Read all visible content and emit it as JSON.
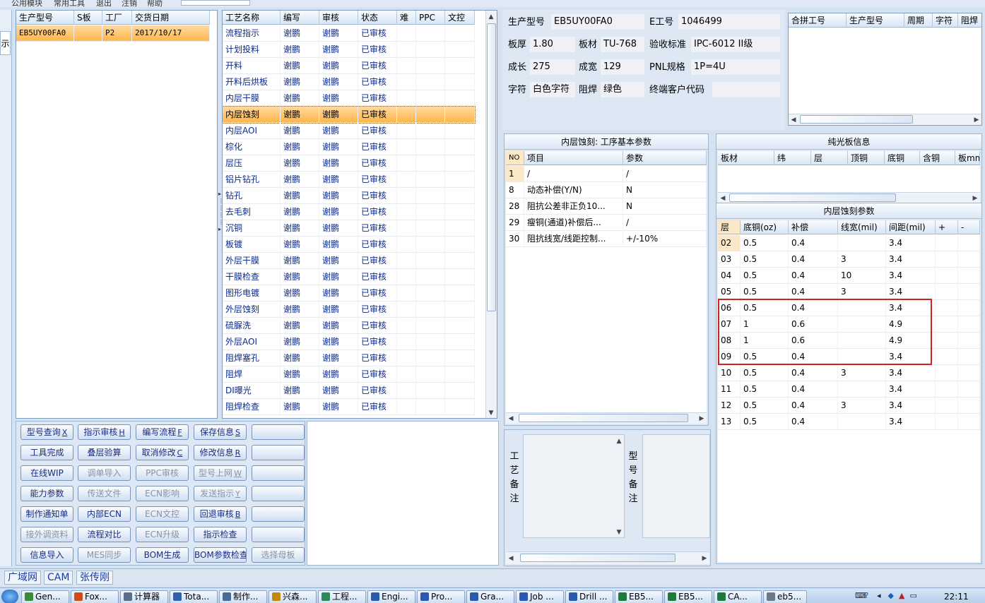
{
  "menu": [
    "公用模块",
    "常用工具",
    "退出",
    "注销",
    "帮助"
  ],
  "left_sidebar_label": "示",
  "order_table": {
    "headers": [
      "生产型号",
      "S板",
      "工厂",
      "交货日期"
    ],
    "rows": [
      [
        "EB5UY00FA0",
        "",
        "P2",
        "2017/10/17"
      ]
    ]
  },
  "process_table": {
    "headers": [
      "工艺名称",
      "编写",
      "审核",
      "状态",
      "难",
      "PPC",
      "文控"
    ],
    "selected_index": 5,
    "rows": [
      [
        "流程指示",
        "谢鹏",
        "谢鹏",
        "已审核"
      ],
      [
        "计划投料",
        "谢鹏",
        "谢鹏",
        "已审核"
      ],
      [
        "开料",
        "谢鹏",
        "谢鹏",
        "已审核"
      ],
      [
        "开料后烘板",
        "谢鹏",
        "谢鹏",
        "已审核"
      ],
      [
        "内层干膜",
        "谢鹏",
        "谢鹏",
        "已审核"
      ],
      [
        "内层蚀刻",
        "谢鹏",
        "谢鹏",
        "已审核"
      ],
      [
        "内层AOI",
        "谢鹏",
        "谢鹏",
        "已审核"
      ],
      [
        "棕化",
        "谢鹏",
        "谢鹏",
        "已审核"
      ],
      [
        "层压",
        "谢鹏",
        "谢鹏",
        "已审核"
      ],
      [
        "铝片钻孔",
        "谢鹏",
        "谢鹏",
        "已审核"
      ],
      [
        "钻孔",
        "谢鹏",
        "谢鹏",
        "已审核"
      ],
      [
        "去毛刺",
        "谢鹏",
        "谢鹏",
        "已审核"
      ],
      [
        "沉铜",
        "谢鹏",
        "谢鹏",
        "已审核"
      ],
      [
        "板镀",
        "谢鹏",
        "谢鹏",
        "已审核"
      ],
      [
        "外层干膜",
        "谢鹏",
        "谢鹏",
        "已审核"
      ],
      [
        "干膜检查",
        "谢鹏",
        "谢鹏",
        "已审核"
      ],
      [
        "图形电镀",
        "谢鹏",
        "谢鹏",
        "已审核"
      ],
      [
        "外层蚀刻",
        "谢鹏",
        "谢鹏",
        "已审核"
      ],
      [
        "硫脲洗",
        "谢鹏",
        "谢鹏",
        "已审核"
      ],
      [
        "外层AOI",
        "谢鹏",
        "谢鹏",
        "已审核"
      ],
      [
        "阻焊塞孔",
        "谢鹏",
        "谢鹏",
        "已审核"
      ],
      [
        "阻焊",
        "谢鹏",
        "谢鹏",
        "已审核"
      ],
      [
        "DI曝光",
        "谢鹏",
        "谢鹏",
        "已审核"
      ],
      [
        "阻焊检查",
        "谢鹏",
        "谢鹏",
        "已审核"
      ]
    ]
  },
  "info": {
    "model_label": "生产型号",
    "model": "EB5UY00FA0",
    "eno_label": "E工号",
    "eno": "1046499",
    "thickness_label": "板厚",
    "thickness": "1.80",
    "material_label": "板材",
    "material": "TU-768",
    "standard_label": "验收标准",
    "standard": "IPC-6012 II级",
    "length_label": "成长",
    "length": "275",
    "width_label": "成宽",
    "width": "129",
    "pnl_label": "PNL规格",
    "pnl": "1P=4U",
    "char_label": "字符",
    "char": "白色字符",
    "mask_label": "阻焊",
    "mask": "绿色",
    "customer_label": "终端客户代码",
    "customer": ""
  },
  "combine_table": {
    "headers": [
      "合拼工号",
      "生产型号",
      "周期",
      "字符",
      "阻焊"
    ]
  },
  "params_panel": {
    "title": "内层蚀刻: 工序基本参数",
    "headers": [
      "NO",
      "项目",
      "参数"
    ],
    "rows": [
      [
        "1",
        "/",
        "/"
      ],
      [
        "8",
        "动态补偿(Y/N)",
        "N"
      ],
      [
        "28",
        "阻抗公差非正负10...",
        "N"
      ],
      [
        "29",
        "瘦铜(通道)补偿后...",
        "/"
      ],
      [
        "30",
        "阻抗线宽/线距控制...",
        "+/-10%"
      ]
    ]
  },
  "bare_panel": {
    "title": "纯光板信息",
    "headers": [
      "板材",
      "纬",
      "层",
      "顶铜",
      "底铜",
      "含铜",
      "板mm"
    ]
  },
  "etch_panel": {
    "title": "内层蚀刻参数",
    "headers": [
      "层",
      "底铜(oz)",
      "补偿",
      "线宽(mil)",
      "间距(mil)",
      "+",
      "-"
    ],
    "rows": [
      [
        "02",
        "0.5",
        "0.4",
        "",
        "3.4"
      ],
      [
        "03",
        "0.5",
        "0.4",
        "3",
        "3.4"
      ],
      [
        "04",
        "0.5",
        "0.4",
        "10",
        "3.4"
      ],
      [
        "05",
        "0.5",
        "0.4",
        "3",
        "3.4"
      ],
      [
        "06",
        "0.5",
        "0.4",
        "",
        "3.4"
      ],
      [
        "07",
        "1",
        "0.6",
        "",
        "4.9"
      ],
      [
        "08",
        "1",
        "0.6",
        "",
        "4.9"
      ],
      [
        "09",
        "0.5",
        "0.4",
        "",
        "3.4"
      ],
      [
        "10",
        "0.5",
        "0.4",
        "3",
        "3.4"
      ],
      [
        "11",
        "0.5",
        "0.4",
        "",
        "3.4"
      ],
      [
        "12",
        "0.5",
        "0.4",
        "3",
        "3.4"
      ],
      [
        "13",
        "0.5",
        "0.4",
        "",
        "3.4"
      ]
    ]
  },
  "remarks": {
    "process_label": "工艺备注",
    "model_label": "型号备注"
  },
  "buttons": [
    [
      {
        "t": "型号查询",
        "k": "X",
        "d": false
      },
      {
        "t": "指示审核",
        "k": "H",
        "d": false
      },
      {
        "t": "编写流程",
        "k": "F",
        "d": false
      },
      {
        "t": "保存信息",
        "k": "S",
        "d": false
      },
      {
        "t": "",
        "k": "",
        "d": false
      }
    ],
    [
      {
        "t": "工具完成",
        "k": "",
        "d": false
      },
      {
        "t": "叠层验算",
        "k": "",
        "d": false
      },
      {
        "t": "取消修改",
        "k": "C",
        "d": false
      },
      {
        "t": "修改信息",
        "k": "R",
        "d": false
      },
      {
        "t": "",
        "k": "",
        "d": false
      }
    ],
    [
      {
        "t": "在线WIP",
        "k": "",
        "d": false
      },
      {
        "t": "调单导入",
        "k": "",
        "d": true
      },
      {
        "t": "PPC审核",
        "k": "",
        "d": true
      },
      {
        "t": "型号上网",
        "k": "W",
        "d": true
      },
      {
        "t": "",
        "k": "",
        "d": false
      }
    ],
    [
      {
        "t": "能力参数",
        "k": "",
        "d": false
      },
      {
        "t": "传送文件",
        "k": "",
        "d": true
      },
      {
        "t": "ECN影响",
        "k": "",
        "d": true
      },
      {
        "t": "发送指示",
        "k": "Y",
        "d": true
      },
      {
        "t": "",
        "k": "",
        "d": false
      }
    ],
    [
      {
        "t": "制作通知单",
        "k": "",
        "d": false
      },
      {
        "t": "内部ECN",
        "k": "",
        "d": false
      },
      {
        "t": "ECN文控",
        "k": "",
        "d": true
      },
      {
        "t": "回退审核",
        "k": "B",
        "d": false
      },
      {
        "t": "",
        "k": "",
        "d": false
      }
    ],
    [
      {
        "t": "接外调资料",
        "k": "",
        "d": true
      },
      {
        "t": "流程对比",
        "k": "",
        "d": false
      },
      {
        "t": "ECN升级",
        "k": "",
        "d": true
      },
      {
        "t": "指示检查",
        "k": "",
        "d": false
      },
      {
        "t": "",
        "k": "",
        "d": false
      }
    ],
    [
      {
        "t": "信息导入",
        "k": "",
        "d": false
      },
      {
        "t": "MES同步",
        "k": "",
        "d": true
      },
      {
        "t": "BOM生成",
        "k": "",
        "d": false
      },
      {
        "t": "BOM参数检查",
        "k": "",
        "d": false
      },
      {
        "t": "选择母板",
        "k": "",
        "d": true
      }
    ]
  ],
  "status_tabs": [
    "广域网",
    "CAM",
    "张传刚"
  ],
  "taskbar": {
    "tasks": [
      {
        "label": "Gen...",
        "color": "#3a8a3a"
      },
      {
        "label": "Fox...",
        "color": "#d24a1a"
      },
      {
        "label": "计算器",
        "color": "#5a6d8a"
      },
      {
        "label": "Tota...",
        "color": "#3060b0"
      },
      {
        "label": "制作...",
        "color": "#4a6a9a"
      },
      {
        "label": "兴森...",
        "color": "#c08a10"
      },
      {
        "label": "工程...",
        "color": "#2a8a5a"
      },
      {
        "label": "Engi...",
        "color": "#2a5ab0"
      },
      {
        "label": "Pro...",
        "color": "#2a5ab0"
      },
      {
        "label": "Gra...",
        "color": "#2a5ab0"
      },
      {
        "label": "Job ...",
        "color": "#2a5ab0"
      },
      {
        "label": "Drill ...",
        "color": "#2a5ab0"
      },
      {
        "label": "EB5...",
        "color": "#1d7a3a"
      },
      {
        "label": "EB5...",
        "color": "#1d7a3a"
      },
      {
        "label": "CA...",
        "color": "#1d7a3a"
      },
      {
        "label": "eb5...",
        "color": "#6a7a8a"
      }
    ],
    "clock": "22:11"
  }
}
